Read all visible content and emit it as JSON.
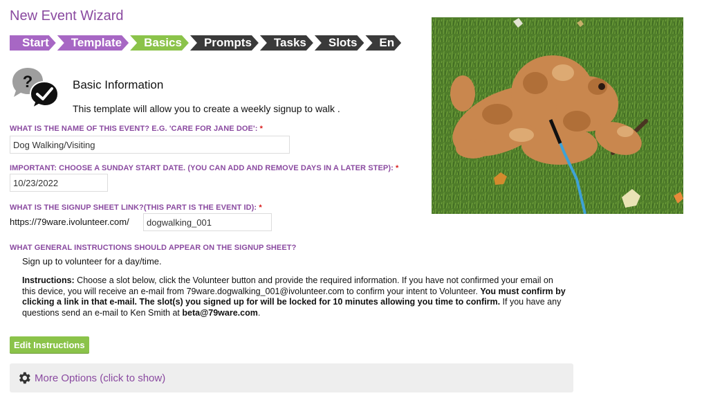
{
  "page": {
    "title": "New Event Wizard"
  },
  "wizard": {
    "steps": [
      {
        "label": "Start",
        "state": "done"
      },
      {
        "label": "Template",
        "state": "done"
      },
      {
        "label": "Basics",
        "state": "current"
      },
      {
        "label": "Prompts",
        "state": "future"
      },
      {
        "label": "Tasks",
        "state": "future"
      },
      {
        "label": "Slots",
        "state": "future"
      },
      {
        "label": "En",
        "state": "future"
      }
    ],
    "colors": {
      "done": "#a767c4",
      "current": "#8bc34a",
      "future": "#3a3a3a"
    }
  },
  "section": {
    "title": "Basic Information",
    "description": "This template will allow you to create a weekly signup to walk ."
  },
  "form": {
    "event_name": {
      "label": "WHAT IS THE NAME OF THIS EVENT? E.G. 'CARE FOR JANE DOE':",
      "required_mark": "*",
      "value": "Dog Walking/Visiting"
    },
    "start_date": {
      "label": "IMPORTANT: CHOOSE A SUNDAY START DATE. (YOU CAN ADD AND REMOVE DAYS IN A LATER STEP):",
      "required_mark": "*",
      "value": "10/23/2022"
    },
    "signup_link": {
      "label": "WHAT IS THE SIGNUP SHEET LINK?(THIS PART IS THE EVENT ID):",
      "required_mark": "*",
      "prefix": "https://79ware.ivolunteer.com/",
      "value": "dogwalking_001"
    },
    "instructions": {
      "label": "WHAT GENERAL INSTRUCTIONS SHOULD APPEAR ON THE SIGNUP SHEET?",
      "short_text": "Sign up to volunteer for a day/time.",
      "bold_lead": "Instructions:",
      "text_1": " Choose a slot below, click the Volunteer button and provide the required information. If you have not confirmed your email on this device, you will receive an e-mail from 79ware.dogwalking_001@ivolunteer.com to confirm your intent to Volunteer. ",
      "bold_confirm": "You must confirm by clicking a link in that e-mail. The slot(s) you signed up for will be locked for 10 minutes allowing you time to confirm.",
      "text_2": " If you have any questions send an e-mail to Ken Smith at ",
      "contact_email": "beta@79ware.com",
      "text_end": "."
    }
  },
  "buttons": {
    "edit_instructions": "Edit Instructions"
  },
  "more_options": {
    "label": "More Options (click to show)",
    "icon": "gear-icon"
  },
  "colors": {
    "accent_purple": "#8a4aa0",
    "accent_green": "#8bc34a",
    "required_red": "#d81b1b"
  }
}
